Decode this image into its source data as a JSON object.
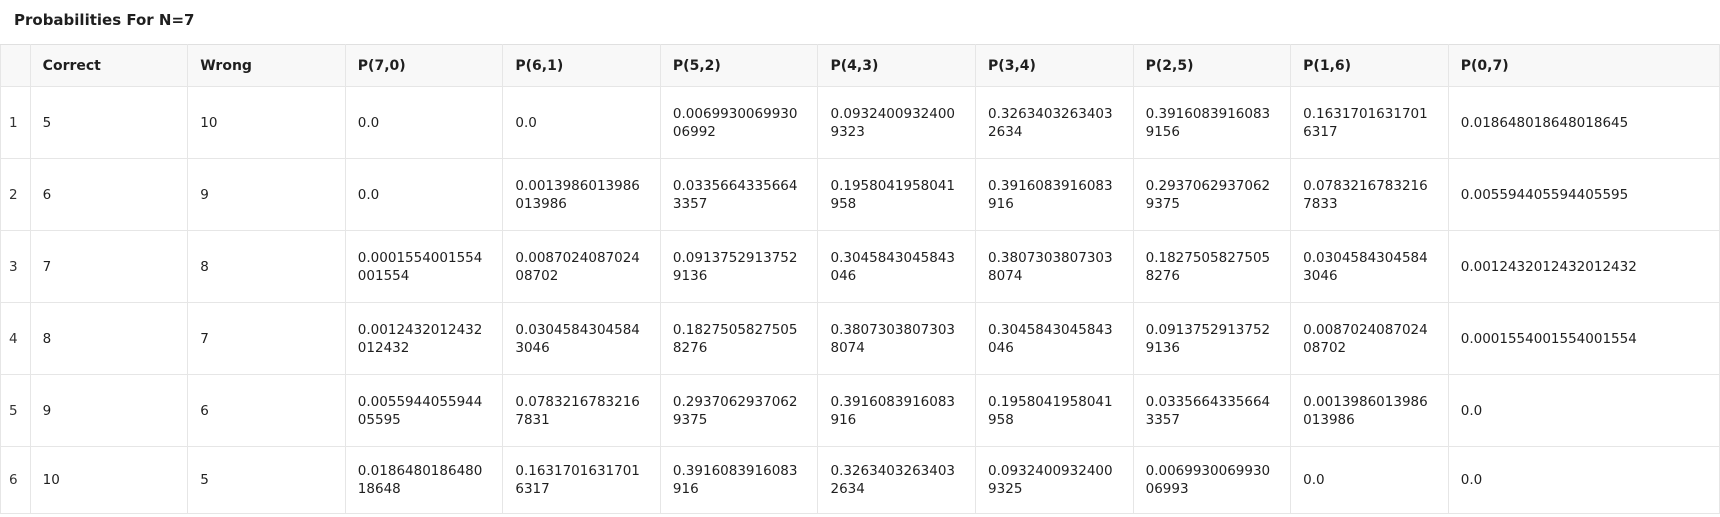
{
  "title": "Probabilities For N=7",
  "columns": [
    "",
    "Correct",
    "Wrong",
    "P(7,0)",
    "P(6,1)",
    "P(5,2)",
    "P(4,3)",
    "P(3,4)",
    "P(2,5)",
    "P(1,6)",
    "P(0,7)"
  ],
  "rows": [
    [
      "1",
      "5",
      "10",
      "0.0",
      "0.0",
      "0.006993006993006992",
      "0.09324009324009323",
      "0.32634032634032634",
      "0.39160839160839156",
      "0.16317016317016317",
      "0.018648018648018645"
    ],
    [
      "2",
      "6",
      "9",
      "0.0",
      "0.0013986013986013986",
      "0.03356643356643357",
      "0.1958041958041958",
      "0.3916083916083916",
      "0.29370629370629375",
      "0.07832167832167833",
      "0.005594405594405595"
    ],
    [
      "3",
      "7",
      "8",
      "0.0001554001554001554",
      "0.008702408702408702",
      "0.09137529137529136",
      "0.3045843045843046",
      "0.38073038073038074",
      "0.18275058275058276",
      "0.03045843045843046",
      "0.0012432012432012432"
    ],
    [
      "4",
      "8",
      "7",
      "0.0012432012432012432",
      "0.03045843045843046",
      "0.18275058275058276",
      "0.38073038073038074",
      "0.3045843045843046",
      "0.09137529137529136",
      "0.008702408702408702",
      "0.0001554001554001554"
    ],
    [
      "5",
      "9",
      "6",
      "0.005594405594405595",
      "0.07832167832167831",
      "0.29370629370629375",
      "0.3916083916083916",
      "0.1958041958041958",
      "0.03356643356643357",
      "0.0013986013986013986",
      "0.0"
    ],
    [
      "6",
      "10",
      "5",
      "0.018648018648018648",
      "0.16317016317016317",
      "0.3916083916083916",
      "0.32634032634032634",
      "0.09324009324009325",
      "0.006993006993006993",
      "0.0",
      "0.0"
    ]
  ]
}
